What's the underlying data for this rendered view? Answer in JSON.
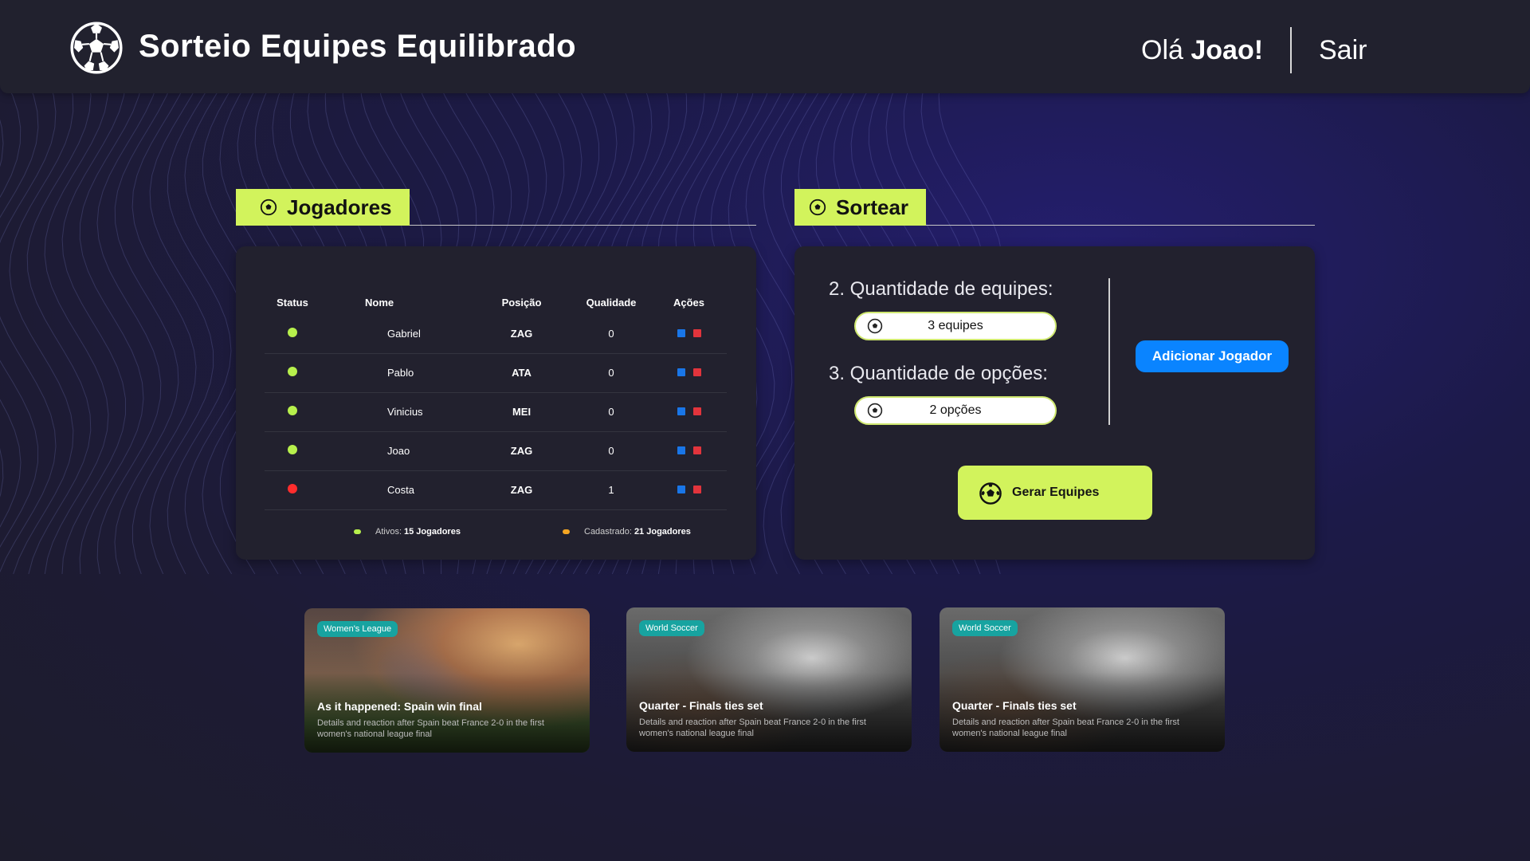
{
  "header": {
    "app_title": "Sorteio Equipes Equilibrado",
    "greeting_prefix": "Olá",
    "user_name": "Joao!",
    "logout_label": "Sair"
  },
  "players_section": {
    "title": "Jogadores",
    "columns": [
      "Status",
      "Nome",
      "Posição",
      "Qualidade",
      "Ações"
    ],
    "rows": [
      {
        "status": "active",
        "name": "Gabriel",
        "position": "ZAG",
        "quality": "0"
      },
      {
        "status": "active",
        "name": "Pablo",
        "position": "ATA",
        "quality": "0"
      },
      {
        "status": "active",
        "name": "Vinicius",
        "position": "MEI",
        "quality": "0"
      },
      {
        "status": "active",
        "name": "Joao",
        "position": "ZAG",
        "quality": "0"
      },
      {
        "status": "inactive",
        "name": "Costa",
        "position": "ZAG",
        "quality": "1"
      }
    ],
    "legend": {
      "active_label": "Ativos:",
      "active_value": "15 Jogadores",
      "registered_label": "Cadastrado:",
      "registered_value": "21 Jogadores"
    },
    "status_colors": {
      "active": "#b7f04c",
      "inactive": "#ff2d2d",
      "registered": "#f5a623"
    }
  },
  "draw_section": {
    "title": "Sortear",
    "teams_label": "2. Quantidade de equipes:",
    "teams_value": "3 equipes",
    "options_label": "3. Quantidade de opções:",
    "options_value": "2 opções",
    "add_player_button": "Adicionar Jogador",
    "generate_button": "Gerar Equipes"
  },
  "news": [
    {
      "tag": "Women's League",
      "title": "As it happened: Spain win final",
      "description": "Details and reaction after Spain beat France 2-0 in the first women's national league final"
    },
    {
      "tag": "World Soccer",
      "title": "Quarter - Finals ties set",
      "description": "Details and reaction after Spain beat France 2-0 in the first women's national league final"
    },
    {
      "tag": "World Soccer",
      "title": "Quarter - Finals ties set",
      "description": "Details and reaction after Spain beat France 2-0 in the first women's national league final"
    }
  ],
  "colors": {
    "accent": "#d2f35c",
    "primary_button": "#0a84ff",
    "badge": "#17a3a0",
    "panel": "#22212e"
  }
}
